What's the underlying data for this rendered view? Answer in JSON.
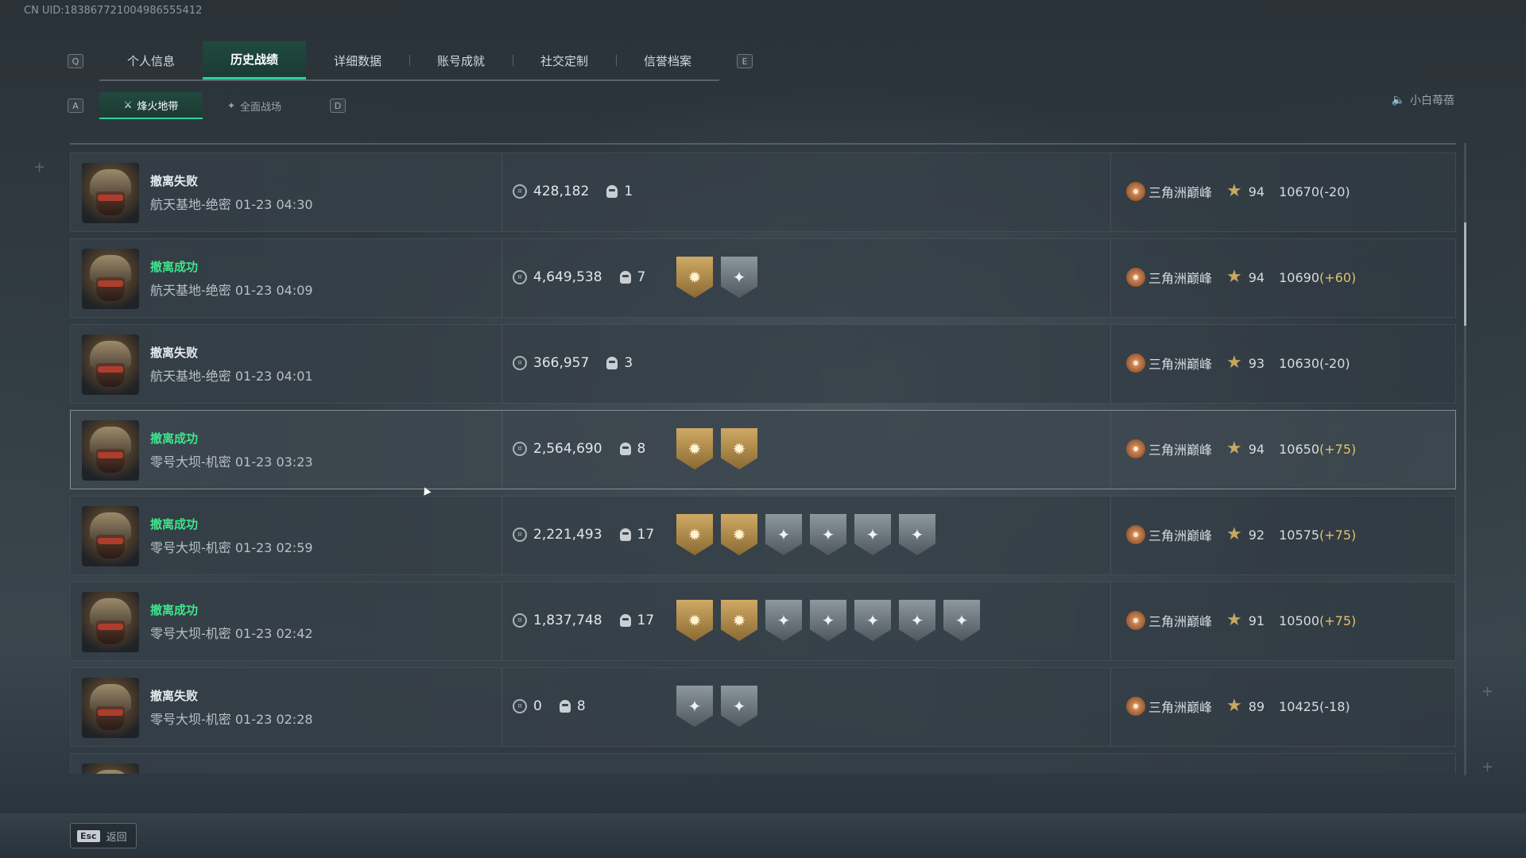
{
  "uid": "CN UID:1838677210049865554​12",
  "tabbar": {
    "left_key": "Q",
    "right_key": "E",
    "tabs": [
      {
        "label": "个人信息",
        "active": false
      },
      {
        "label": "历史战绩",
        "active": true
      },
      {
        "label": "详细数据",
        "active": false
      },
      {
        "label": "账号成就",
        "active": false
      },
      {
        "label": "社交定制",
        "active": false
      },
      {
        "label": "信誉档案",
        "active": false
      }
    ]
  },
  "subbar": {
    "left_key": "A",
    "right_key": "D",
    "tabs": [
      {
        "label": "烽火地带",
        "icon": "⚔",
        "active": true
      },
      {
        "label": "全面战场",
        "icon": "✦",
        "active": false
      }
    ]
  },
  "voice_label": "小白苺蓓",
  "rows": [
    {
      "status": "撤离失败",
      "success": false,
      "location": "航天基地-绝密 01-23 04:30",
      "money": "428,182",
      "kills": "1",
      "badges": [],
      "rank": "三角洲巅峰",
      "level": "94",
      "score": "10670",
      "delta": "(-20)",
      "delta_positive": false
    },
    {
      "status": "撤离成功",
      "success": true,
      "location": "航天基地-绝密 01-23 04:09",
      "money": "4,649,538",
      "kills": "7",
      "badges": [
        "gold",
        "silver"
      ],
      "rank": "三角洲巅峰",
      "level": "94",
      "score": "10690",
      "delta": "(+60)",
      "delta_positive": true
    },
    {
      "status": "撤离失败",
      "success": false,
      "location": "航天基地-绝密 01-23 04:01",
      "money": "366,957",
      "kills": "3",
      "badges": [],
      "rank": "三角洲巅峰",
      "level": "93",
      "score": "10630",
      "delta": "(-20)",
      "delta_positive": false
    },
    {
      "status": "撤离成功",
      "success": true,
      "location": "零号大坝-机密 01-23 03:23",
      "money": "2,564,690",
      "kills": "8",
      "badges": [
        "gold",
        "gold"
      ],
      "rank": "三角洲巅峰",
      "level": "94",
      "score": "10650",
      "delta": "(+75)",
      "delta_positive": true
    },
    {
      "status": "撤离成功",
      "success": true,
      "location": "零号大坝-机密 01-23 02:59",
      "money": "2,221,493",
      "kills": "17",
      "badges": [
        "gold",
        "gold",
        "silver",
        "silver",
        "silver",
        "silver"
      ],
      "rank": "三角洲巅峰",
      "level": "92",
      "score": "10575",
      "delta": "(+75)",
      "delta_positive": true
    },
    {
      "status": "撤离成功",
      "success": true,
      "location": "零号大坝-机密 01-23 02:42",
      "money": "1,837,748",
      "kills": "17",
      "badges": [
        "gold",
        "gold",
        "silver",
        "silver",
        "silver",
        "silver",
        "silver"
      ],
      "rank": "三角洲巅峰",
      "level": "91",
      "score": "10500",
      "delta": "(+75)",
      "delta_positive": true
    },
    {
      "status": "撤离失败",
      "success": false,
      "location": "零号大坝-机密 01-23 02:28",
      "money": "0",
      "kills": "8",
      "badges": [
        "silver",
        "silver"
      ],
      "rank": "三角洲巅峰",
      "level": "89",
      "score": "10425",
      "delta": "(-18)",
      "delta_positive": false
    }
  ],
  "esc": {
    "key": "Esc",
    "label": "返回"
  }
}
